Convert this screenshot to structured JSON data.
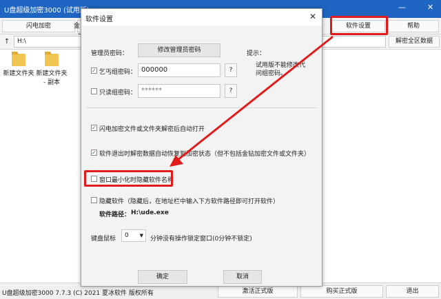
{
  "window": {
    "title": "U盘超级加密3000 (试用版)",
    "minimize": "—",
    "close": "✕"
  },
  "toolbar": {
    "flash_encrypt": "闪电加密",
    "gold_partial": "金钻",
    "software_settings": "软件设置",
    "help": "帮助"
  },
  "address": {
    "up": "↑",
    "path": "H:\\",
    "decrypt_all": "解密全区数据"
  },
  "files": [
    {
      "name": "新建文件夹"
    },
    {
      "name": "新建文件夹 - 副本"
    }
  ],
  "status": {
    "text": "U盘超级加密3000 7.7.3 (C) 2021 夏冰软件 版权所有",
    "register": "激活正式版",
    "buy": "购买正式版",
    "exit": "退出"
  },
  "dialog": {
    "title": "软件设置",
    "close": "✕",
    "admin_label": "管理员密码：",
    "admin_button": "修改管理员密码",
    "hint_label": "提示：",
    "hint_text": "试用版不能修改代问组密码。",
    "beggar_label": "乞丐组密码：",
    "beggar_value": "000000",
    "beggar_help": "?",
    "readonly_label": "只读组密码：",
    "readonly_value": "******",
    "readonly_help": "?",
    "opt_auto_open": "闪电加密文件或文件夹解密后自动打开",
    "opt_restore": "软件退出时解密数据自动恢复到加密状态（但不包括金钻加密文件或文件夹）",
    "opt_hide_min": "窗口最小化时隐藏软件名称",
    "opt_hide_soft": "隐藏软件（隐藏后，在地址栏中输入下方软件路径即可打开软件）",
    "path_label": "软件路径：",
    "path_value": "H:\\ude.exe",
    "lock_label": "键盘鼠标",
    "lock_value": "0",
    "lock_suffix": "分钟没有操作锁定窗口(0分钟不锁定)",
    "ok": "确定",
    "cancel": "取消",
    "check_mark": "✓"
  },
  "colors": {
    "titlebar": "#1f66c2",
    "annotation_red": "#e11b1b"
  }
}
